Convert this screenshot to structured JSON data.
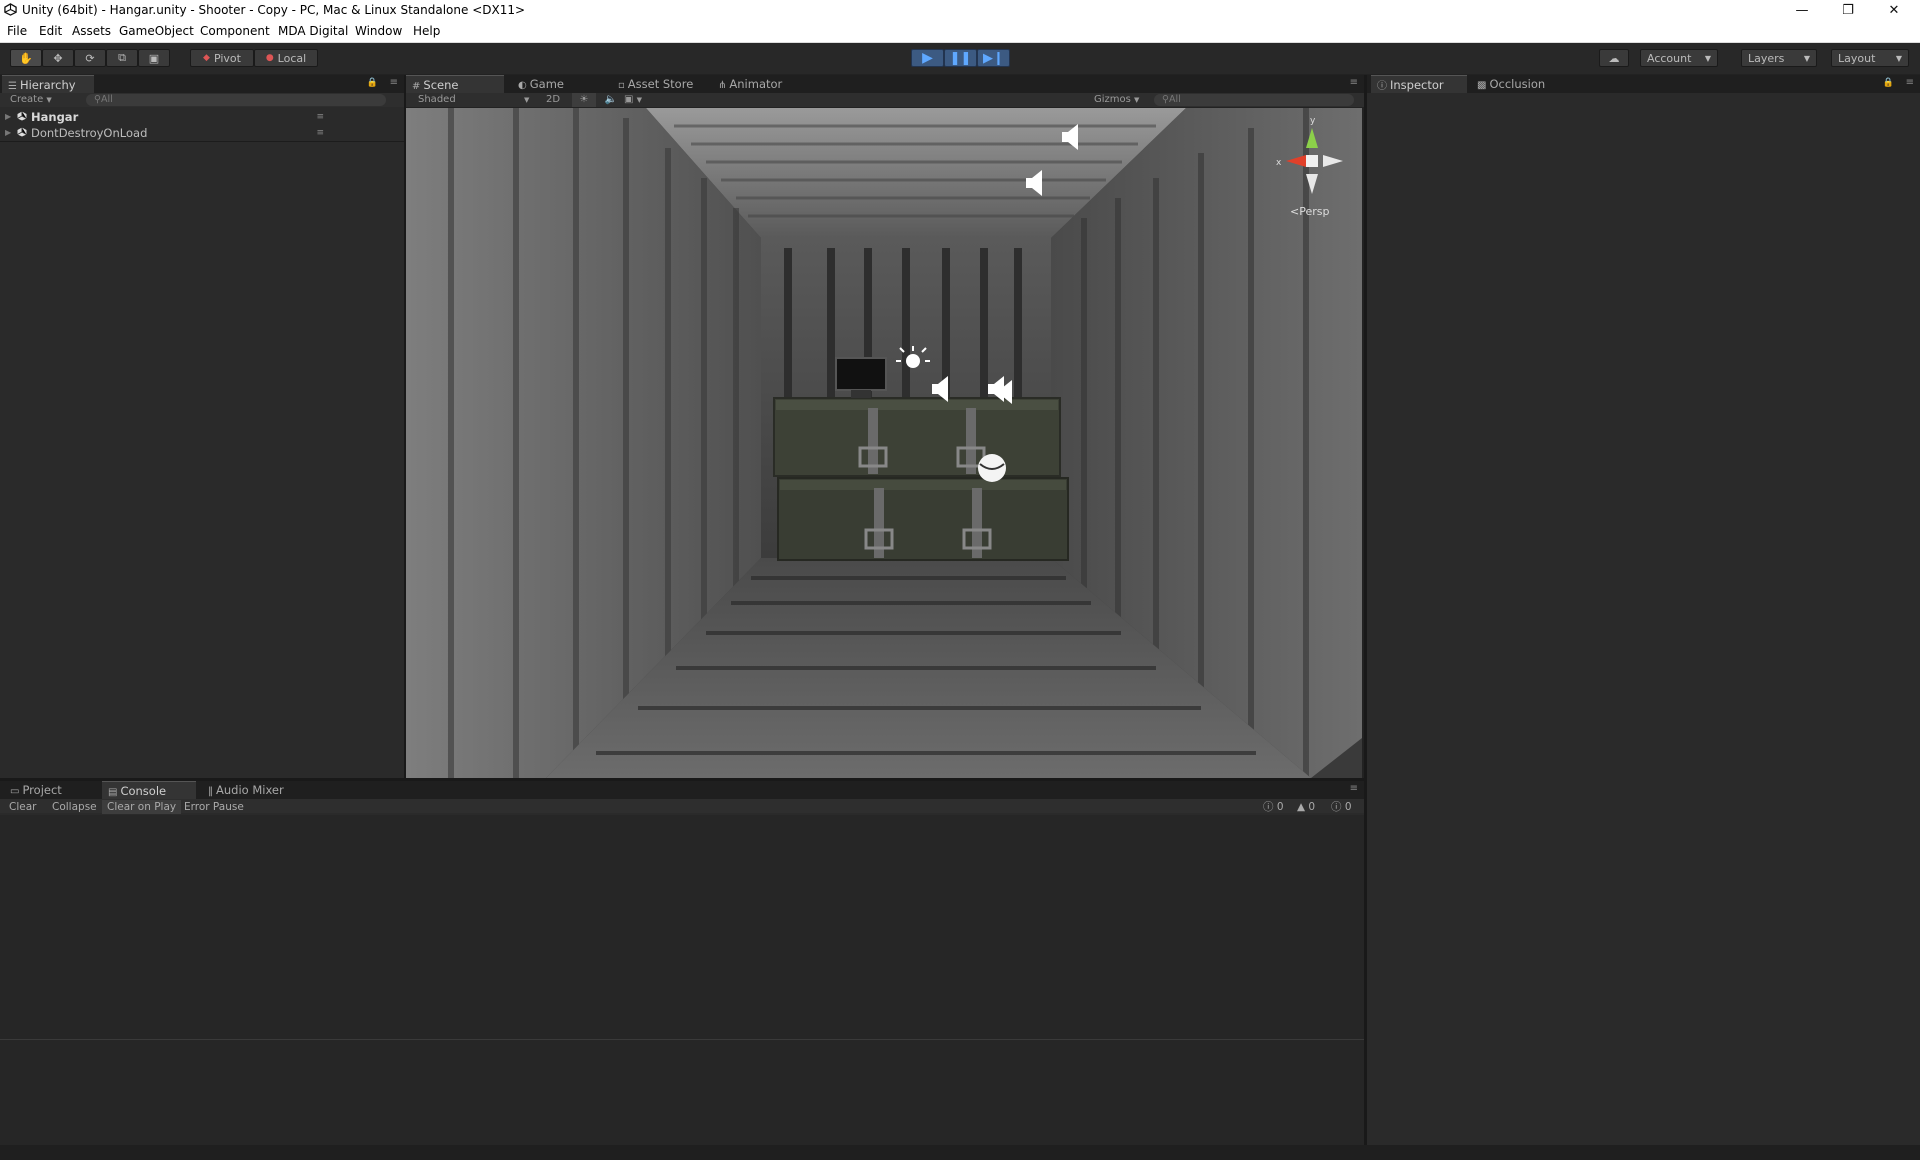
{
  "window": {
    "title": "Unity (64bit) - Hangar.unity - Shooter - Copy - PC, Mac & Linux Standalone <DX11>",
    "minimize_icon": "minimize-icon",
    "maximize_icon": "restore-icon",
    "close_icon": "close-icon"
  },
  "menu": [
    "File",
    "Edit",
    "Assets",
    "GameObject",
    "Component",
    "MDA Digital",
    "Window",
    "Help"
  ],
  "toolbar": {
    "pivot_label": "Pivot",
    "local_label": "Local",
    "account_label": "Account",
    "layers_label": "Layers",
    "layout_label": "Layout"
  },
  "hierarchy": {
    "tab": "Hierarchy",
    "create_label": "Create",
    "search_placeholder": "All",
    "items": [
      {
        "label": "Hangar",
        "bold": true
      },
      {
        "label": "DontDestroyOnLoad",
        "bold": false
      }
    ]
  },
  "scene": {
    "tabs": [
      "Scene",
      "Game",
      "Asset Store",
      "Animator"
    ],
    "shading_mode": "Shaded",
    "mode_2d": "2D",
    "gizmos_label": "Gizmos",
    "search_placeholder": "All",
    "gizmo": {
      "y_label": "y",
      "x_label": "x",
      "projection": "Persp"
    }
  },
  "inspector": {
    "tabs": [
      "Inspector",
      "Occlusion"
    ]
  },
  "bottom": {
    "tabs": [
      "Project",
      "Console",
      "Audio Mixer"
    ],
    "console_tools": [
      "Clear",
      "Collapse",
      "Clear on Play",
      "Error Pause"
    ],
    "counts": {
      "errors": "0",
      "warnings": "0",
      "messages": "0"
    }
  },
  "colors": {
    "play_blue": "#3c5a82",
    "panel_bg": "#2a2a2a",
    "gizmo_red": "#e0402a",
    "gizmo_green": "#8cd04a"
  }
}
